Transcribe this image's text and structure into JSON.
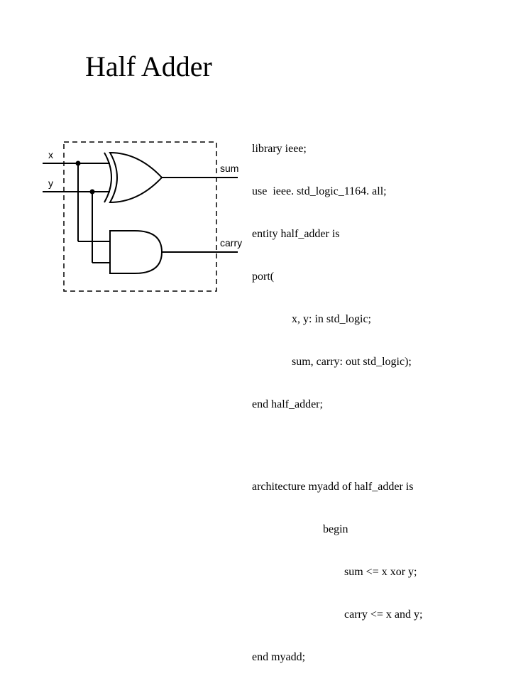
{
  "title": "Half Adder",
  "diagram": {
    "labels": {
      "x": "x",
      "y": "y",
      "sum": "sum",
      "carry": "carry"
    },
    "gates": [
      "XOR",
      "AND"
    ]
  },
  "code": {
    "l1": "library ieee;",
    "l2": "use  ieee. std_logic_1164. all;",
    "l3": "entity half_adder is",
    "l4": "port(",
    "l5": "x, y: in std_logic;",
    "l6": "sum, carry: out std_logic);",
    "l7": "end half_adder;",
    "l8": "architecture myadd of half_adder is",
    "l9": "begin",
    "l10": "sum <= x xor y;",
    "l11": "carry <= x and y;",
    "l12": "end myadd;"
  }
}
